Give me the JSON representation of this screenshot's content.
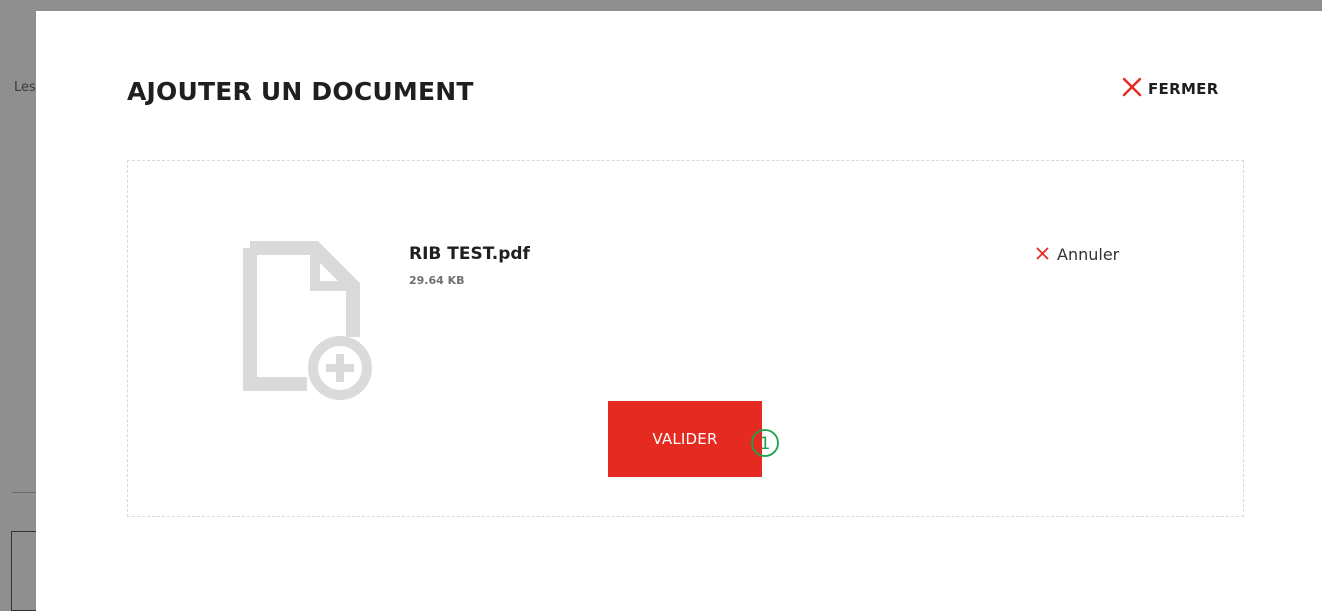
{
  "backdrop": {
    "fragment_text": "Les"
  },
  "modal": {
    "title": "AJOUTER UN DOCUMENT",
    "close_label": "FERMER",
    "close_icon": "close-x-icon"
  },
  "upload": {
    "file_name": "RIB TEST.pdf",
    "file_size": "29.64 KB",
    "cancel_label": "Annuler",
    "cancel_icon": "close-x-icon",
    "document_icon": "document-add-icon"
  },
  "actions": {
    "validate_label": "VALIDER"
  },
  "annotation": {
    "step_marker": "1"
  },
  "colors": {
    "accent": "#e42a21",
    "step_marker": "#1aa34a",
    "icon_grey": "#dadada"
  }
}
